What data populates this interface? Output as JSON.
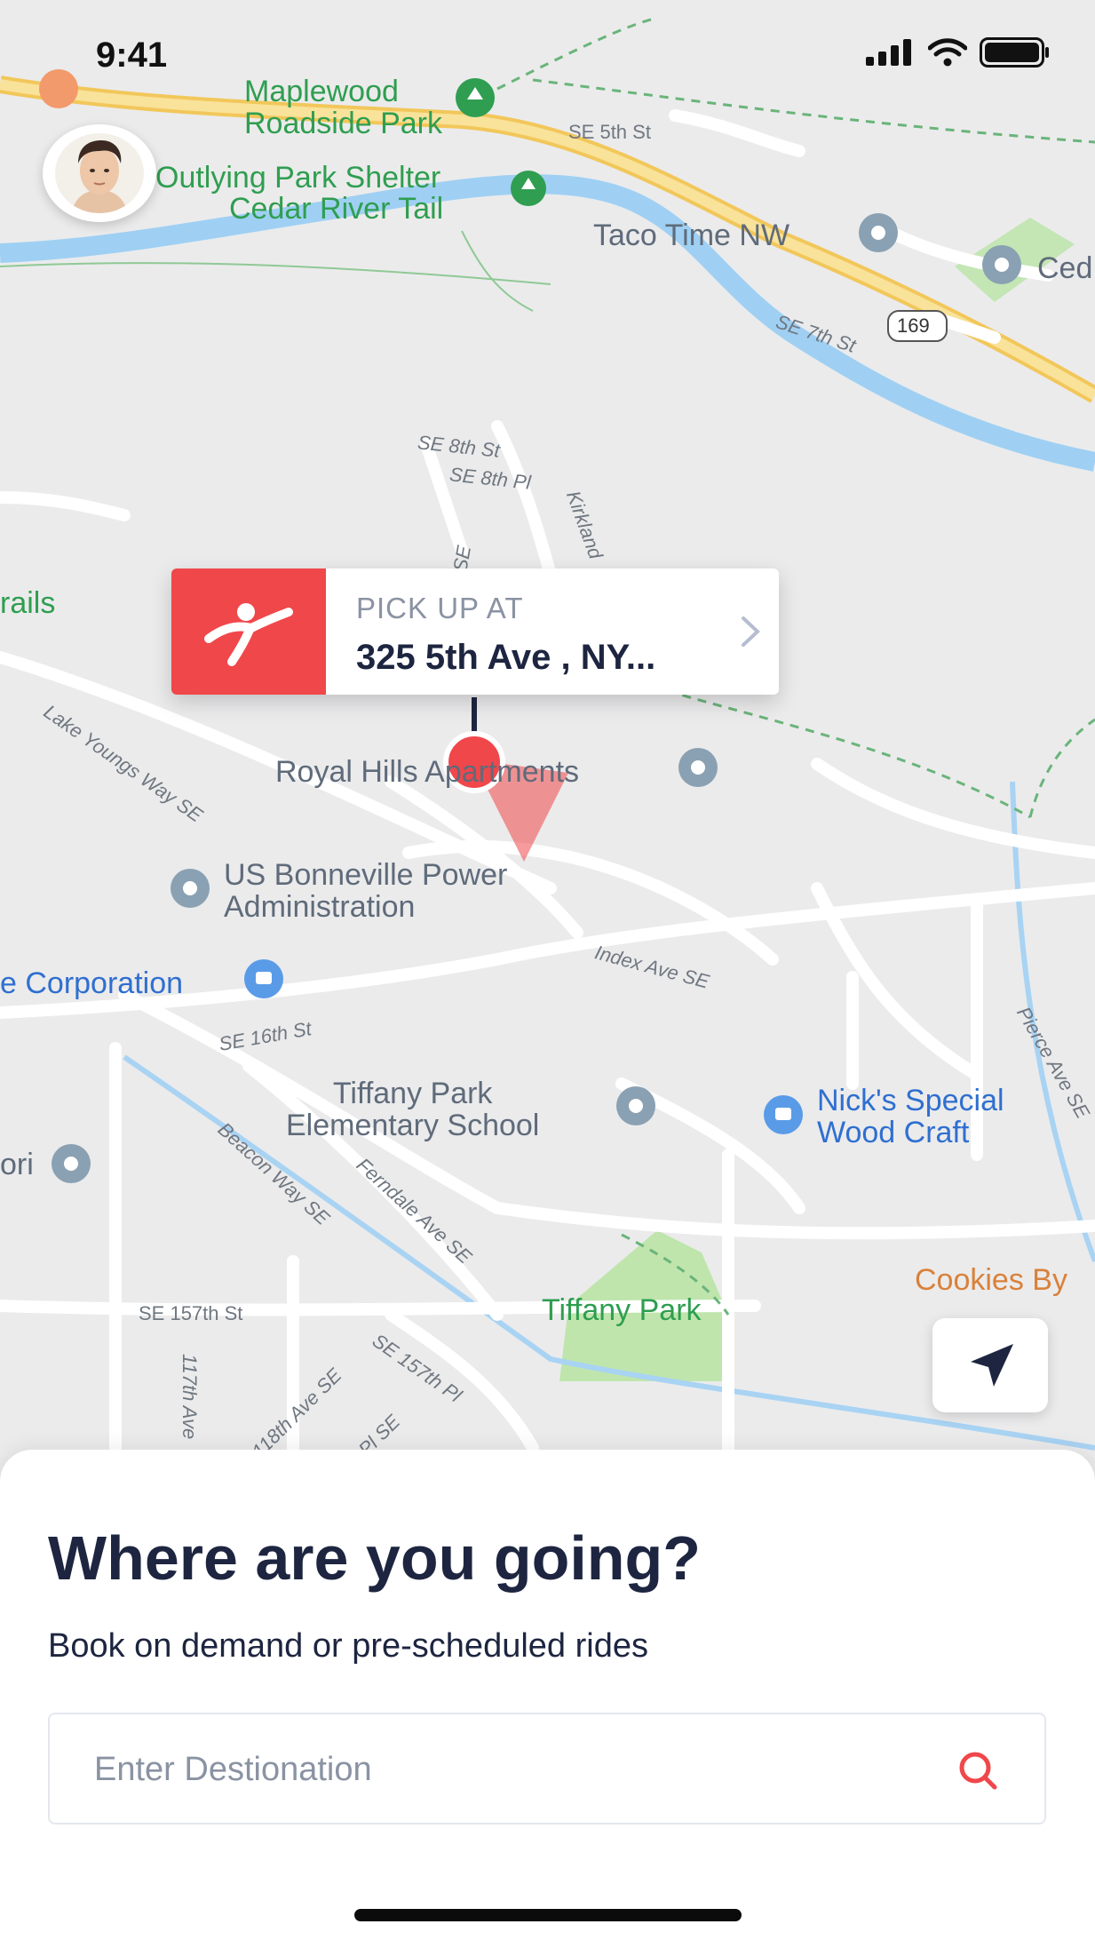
{
  "status": {
    "time": "9:41"
  },
  "map": {
    "labels": {
      "maplewood": "Maplewood\nRoadside Park",
      "outlying": "Outlying Park Shelter",
      "cedar_trail": "Cedar River Tail",
      "se_5th": "SE 5th St",
      "taco": "Taco Time NW",
      "ced": "Ced",
      "se_7th": "SE 7th St",
      "route": "169",
      "se_8th_st": "SE 8th St",
      "se_8th_pl": "SE 8th Pl",
      "kirkland": "Kirkland",
      "se_vert": "SE",
      "trails": "rails",
      "lake_youngs": "Lake Youngs Way SE",
      "royal_hills": "Royal Hills Apartments",
      "bonneville": "US Bonneville Power\nAdministration",
      "corporation": "e Corporation",
      "index_ave": "Index Ave SE",
      "se_16th": "SE 16th St",
      "tiffany_school": "Tiffany Park\nElementary School",
      "nicks": "Nick's Special\nWood Craft",
      "pierce": "Pierce Ave SE",
      "ori": "ori",
      "beacon": "Beacon Way SE",
      "ferndale": "Ferndale Ave SE",
      "cookies": "Cookies By",
      "se_157th_st": "SE 157th St",
      "tiffany_park": "Tiffany Park",
      "se_157th_pl": "SE 157th Pl",
      "ave_117": "117th Ave",
      "ave_118": "118th Ave SE",
      "pl_se": "Pl SE"
    }
  },
  "pickup": {
    "label": "PICK UP AT",
    "address": "325 5th Ave , NY..."
  },
  "sheet": {
    "title": "Where are you going?",
    "subtitle": "Book on demand or pre-scheduled rides",
    "destination_placeholder": "Enter Destionation"
  },
  "icons": {
    "avatar": "user-avatar",
    "pickup": "walking-person-icon",
    "locate": "navigation-arrow-icon",
    "search": "search-icon"
  },
  "colors": {
    "accent": "#f0474b",
    "text": "#1d2540",
    "muted": "#8a93a3",
    "water": "#9fd0f3",
    "park": "#b9e3a8",
    "highway": "#f7d77a"
  }
}
